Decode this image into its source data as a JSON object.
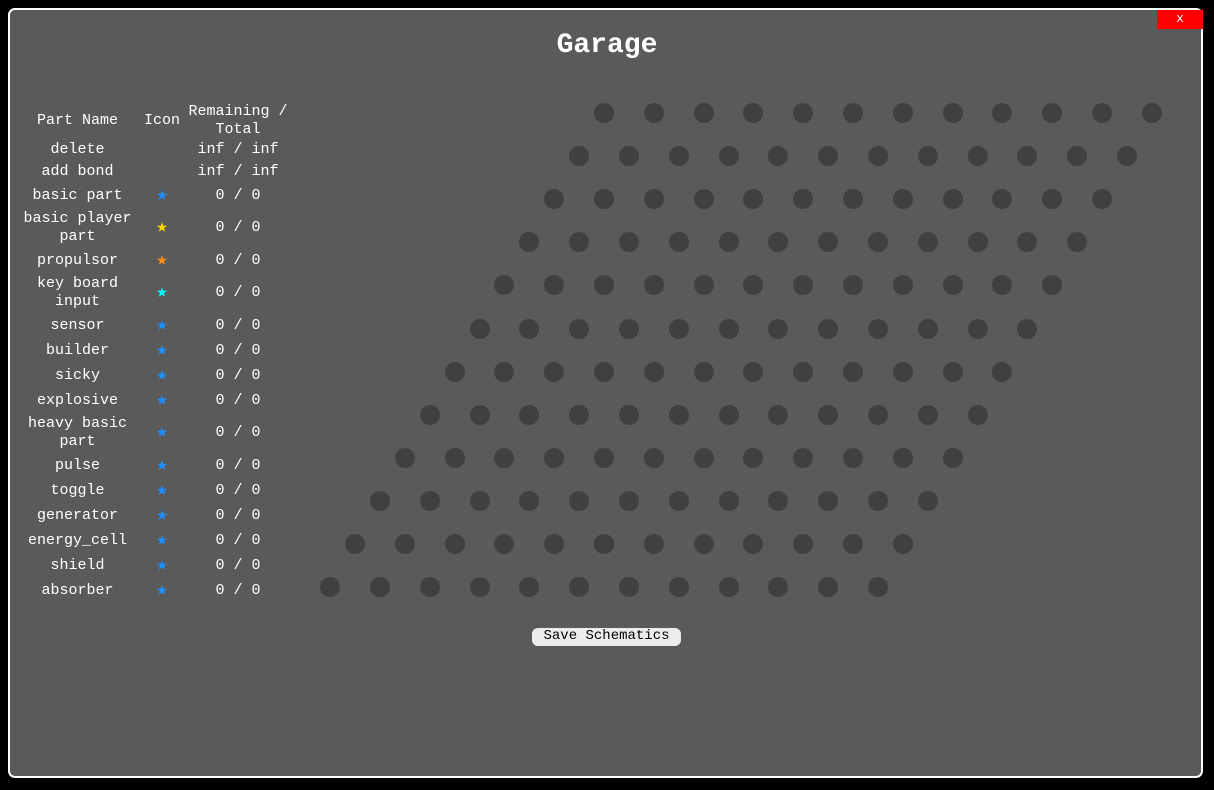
{
  "window": {
    "title": "Garage",
    "close_label": "x"
  },
  "table": {
    "headers": {
      "name": "Part Name",
      "icon": "Icon",
      "remaining": "Remaining / Total"
    },
    "rows": [
      {
        "name": "delete",
        "icon": null,
        "icon_color": null,
        "count": "inf / inf"
      },
      {
        "name": "add bond",
        "icon": null,
        "icon_color": null,
        "count": "inf / inf"
      },
      {
        "name": "basic part",
        "icon": "star-icon",
        "icon_color": "#1e90ff",
        "count": "0 / 0"
      },
      {
        "name": "basic player part",
        "icon": "star-icon",
        "icon_color": "#ffd700",
        "count": "0 / 0"
      },
      {
        "name": "propulsor",
        "icon": "star-icon",
        "icon_color": "#ff8c1a",
        "count": "0 / 0"
      },
      {
        "name": "key board input",
        "icon": "star-icon",
        "icon_color": "#00ffff",
        "count": "0 / 0"
      },
      {
        "name": "sensor",
        "icon": "star-icon",
        "icon_color": "#1e90ff",
        "count": "0 / 0"
      },
      {
        "name": "builder",
        "icon": "star-icon",
        "icon_color": "#1e90ff",
        "count": "0 / 0"
      },
      {
        "name": "sicky",
        "icon": "star-icon",
        "icon_color": "#1e90ff",
        "count": "0 / 0"
      },
      {
        "name": "explosive",
        "icon": "star-icon",
        "icon_color": "#1e90ff",
        "count": "0 / 0"
      },
      {
        "name": "heavy basic part",
        "icon": "star-icon",
        "icon_color": "#1e90ff",
        "count": "0 / 0"
      },
      {
        "name": "pulse",
        "icon": "star-icon",
        "icon_color": "#1e90ff",
        "count": "0 / 0"
      },
      {
        "name": "toggle",
        "icon": "star-icon",
        "icon_color": "#1e90ff",
        "count": "0 / 0"
      },
      {
        "name": "generator",
        "icon": "star-icon",
        "icon_color": "#1e90ff",
        "count": "0 / 0"
      },
      {
        "name": "energy_cell",
        "icon": "star-icon",
        "icon_color": "#1e90ff",
        "count": "0 / 0"
      },
      {
        "name": "shield",
        "icon": "star-icon",
        "icon_color": "#1e90ff",
        "count": "0 / 0"
      },
      {
        "name": "absorber",
        "icon": "star-icon",
        "icon_color": "#1e90ff",
        "count": "0 / 0"
      }
    ]
  },
  "grid": {
    "rows": 12,
    "columns": 12,
    "slot_color": "#404040"
  },
  "save_button": {
    "label": "Save Schematics"
  }
}
